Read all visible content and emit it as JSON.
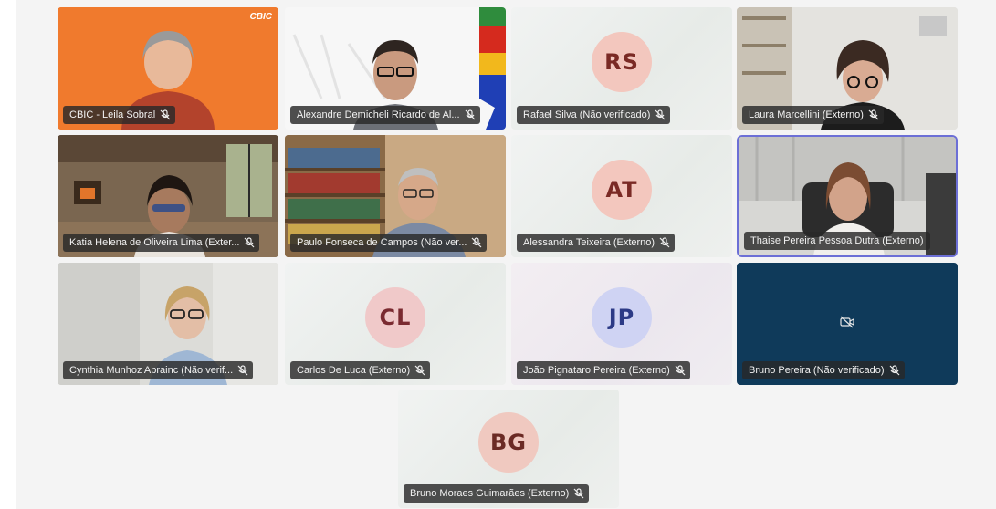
{
  "meeting": {
    "participants": [
      {
        "name": "CBIC - Leila Sobral",
        "video": true,
        "muted": true,
        "org_label": "CBIC"
      },
      {
        "name": "Alexandre Demicheli Ricardo de Al...",
        "video": true,
        "muted": true
      },
      {
        "name": "Rafael Silva (Não verificado)",
        "video": false,
        "initials": "RS",
        "muted": true
      },
      {
        "name": "Laura Marcellini (Externo)",
        "video": true,
        "muted": true
      },
      {
        "name": "Katia Helena de Oliveira Lima (Exter...",
        "video": true,
        "muted": true
      },
      {
        "name": "Paulo Fonseca de Campos (Não ver...",
        "video": true,
        "muted": true
      },
      {
        "name": "Alessandra Teixeira (Externo)",
        "video": false,
        "initials": "AT",
        "muted": true
      },
      {
        "name": "Thaise Pereira Pessoa Dutra (Externo)",
        "video": true,
        "muted": false,
        "active_speaker": true
      },
      {
        "name": "Cynthia Munhoz Abrainc (Não verif...",
        "video": true,
        "muted": true
      },
      {
        "name": "Carlos De Luca (Externo)",
        "video": false,
        "initials": "CL",
        "muted": true
      },
      {
        "name": "João Pignataro Pereira (Externo)",
        "video": false,
        "initials": "JP",
        "muted": true
      },
      {
        "name": "Bruno Pereira (Não verificado)",
        "video": false,
        "camera_off_icon": "video-off-icon",
        "muted": true
      },
      {
        "name": "Bruno Moraes Guimarães (Externo)",
        "video": false,
        "initials": "BG",
        "muted": true
      }
    ]
  },
  "colors": {
    "accent_active": "#6c6fd6",
    "nameplate_bg": "#282828",
    "orange_bg": "#f07a2d",
    "navy_tile": "#0f3a5a"
  }
}
